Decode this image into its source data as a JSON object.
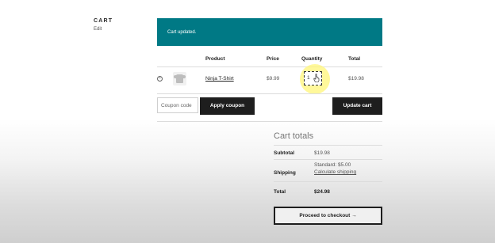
{
  "sidebar": {
    "title": "CART",
    "edit_link": "Edit"
  },
  "notice": {
    "text": "Cart updated.",
    "color": "#007985"
  },
  "table": {
    "headers": {
      "product": "Product",
      "price": "Price",
      "quantity": "Quantity",
      "total": "Total"
    },
    "rows": [
      {
        "remove": "×",
        "product": "Ninja T-Shirt",
        "price": "$9.99",
        "quantity": "1",
        "total": "$19.98"
      }
    ]
  },
  "coupon": {
    "placeholder": "Coupon code",
    "apply_label": "Apply coupon"
  },
  "update_cart_label": "Update cart",
  "totals": {
    "title": "Cart totals",
    "subtotal_label": "Subtotal",
    "subtotal_value": "$19.98",
    "shipping_label": "Shipping",
    "shipping_value": "Standard: $5.00",
    "shipping_link": "Calculate shipping",
    "total_label": "Total",
    "total_value": "$24.98"
  },
  "checkout_label": "Proceed to checkout →",
  "icons": {
    "remove": "remove-circle-icon",
    "thumbnail": "tshirt-thumbnail",
    "cursor": "hand-pointer-icon"
  }
}
